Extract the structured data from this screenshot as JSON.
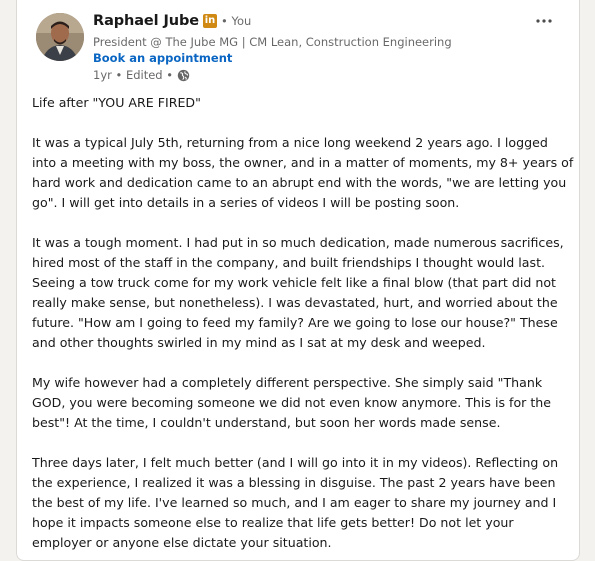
{
  "post": {
    "author_name": "Raphael Jube",
    "badge_letters": "in",
    "you_label": "• You",
    "headline": "President @ The Jube MG | CM Lean, Construction Engineering",
    "appointment_label": "Book an appointment",
    "time_label": "1yr • Edited •",
    "visibility_icon": "globe-icon",
    "more_icon": "more-options-icon"
  },
  "body": {
    "title": "Life after \"YOU ARE FIRED\"",
    "p1": [
      "It was a typical July 5th, returning from a nice long weekend 2 years ago. I logged",
      "into a meeting with my boss, the owner, and in a matter of moments, my 8+ years of",
      "hard work and dedication came to an abrupt end with the words, \"we are letting you",
      "go\". I will get into details in a series of videos I will be posting soon."
    ],
    "p2": [
      "It was a tough moment. I had put in so much dedication, made numerous sacrifices,",
      "hired most of the staff in the company, and built friendships I thought would last.",
      "Seeing a tow truck come for my work vehicle felt like a final blow (that part did not",
      "really make sense, but nonetheless). I was devastated, hurt, and worried about the",
      "future. \"How am I going to feed my family? Are we going to lose our house?\" These",
      "and other thoughts swirled in my mind as I sat at my desk and weeped."
    ],
    "p3": [
      "My wife however had a completely different perspective. She simply said \"Thank",
      "GOD, you were becoming someone we did not even know anymore. This is for the",
      "best\"! At the time, I couldn't understand, but soon her words made sense."
    ],
    "p4": [
      "Three days later, I felt much better (and I will go into it in my videos). Reflecting on",
      "the experience, I realized it was a blessing in disguise. The past 2 years have been",
      "the best of my life. I've learned so much, and I am eager to share my journey and I",
      "hope it impacts someone else to realize that life gets better! Do not let your",
      "employer or anyone else dictate your situation."
    ]
  },
  "colors": {
    "link": "#0a66c2",
    "badge": "#d08a13",
    "page_bg": "#f4f2ee"
  }
}
